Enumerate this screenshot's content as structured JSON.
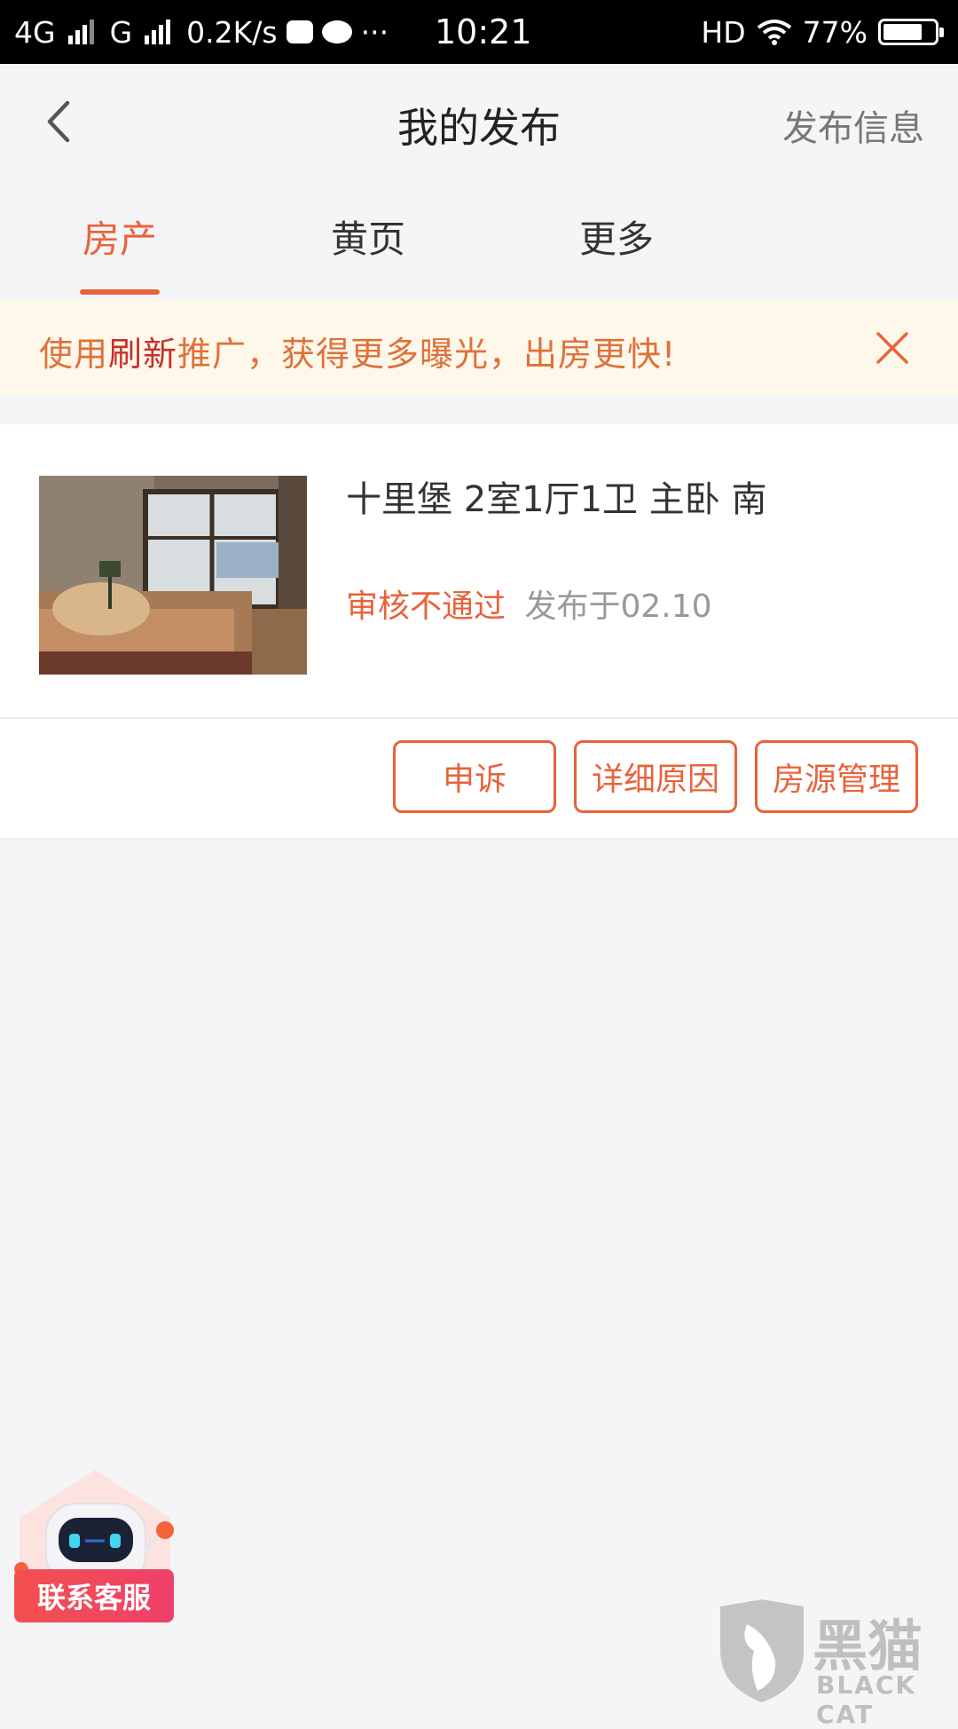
{
  "status_bar": {
    "network_1": "4G",
    "network_2": "G",
    "speed": "0.2K/s",
    "more": "···",
    "time": "10:21",
    "hd": "HD",
    "battery": "77%",
    "battery_level": 0.77
  },
  "header": {
    "title": "我的发布",
    "publish_link": "发布信息"
  },
  "tabs": [
    {
      "label": "房产",
      "active": true
    },
    {
      "label": "黄页",
      "active": false
    },
    {
      "label": "更多",
      "active": false
    }
  ],
  "promo": {
    "prefix": "使用",
    "highlight": "刷新",
    "suffix": "推广，获得更多曝光，出房更快!"
  },
  "listing": {
    "title": "十里堡 2室1厅1卫 主卧 南",
    "status": "审核不通过",
    "publish_date": "发布于02.10"
  },
  "actions": {
    "appeal": "申诉",
    "details": "详细原因",
    "manage": "房源管理"
  },
  "customer_service": {
    "label": "联系客服"
  },
  "watermark": {
    "cn": "黑猫",
    "en": "BLACK CAT"
  },
  "colors": {
    "accent": "#e8633a",
    "highlight": "#c8312a",
    "banner_bg": "#fdf8ea",
    "cs_label": "#f2504f"
  }
}
